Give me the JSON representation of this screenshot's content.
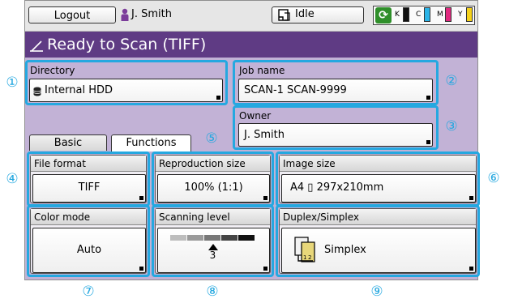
{
  "topbar": {
    "logout_label": "Logout",
    "user_name": "J. Smith",
    "status_label": "Idle",
    "ink": [
      {
        "label": "K",
        "color": "#111111"
      },
      {
        "label": "C",
        "color": "#2bb4e8"
      },
      {
        "label": "M",
        "color": "#e0297f"
      },
      {
        "label": "Y",
        "color": "#f5d21b"
      }
    ]
  },
  "title": "Ready to Scan (TIFF)",
  "directory": {
    "label": "Directory",
    "value": "Internal HDD"
  },
  "job_name": {
    "label": "Job name",
    "value": "SCAN-1 SCAN-9999"
  },
  "owner": {
    "label": "Owner",
    "value": "J. Smith"
  },
  "tabs": {
    "basic": "Basic",
    "functions": "Functions"
  },
  "file_format": {
    "label": "File format",
    "value": "TIFF"
  },
  "reproduction_size": {
    "label": "Reproduction size",
    "value": "100% (1:1)"
  },
  "image_size": {
    "label": "Image size",
    "value": "A4 ▯ 297x210mm"
  },
  "color_mode": {
    "label": "Color mode",
    "value": "Auto"
  },
  "scanning_level": {
    "label": "Scanning level",
    "value": "3",
    "level": 3,
    "steps": 5
  },
  "duplex_simplex": {
    "label": "Duplex/Simplex",
    "value": "Simplex"
  },
  "callouts": [
    "①",
    "②",
    "③",
    "④",
    "⑤",
    "⑥",
    "⑦",
    "⑧",
    "⑨"
  ],
  "colors": {
    "highlight": "#25a8e0",
    "title_bar": "#5f3b84",
    "panel": "#c2b2d6"
  }
}
